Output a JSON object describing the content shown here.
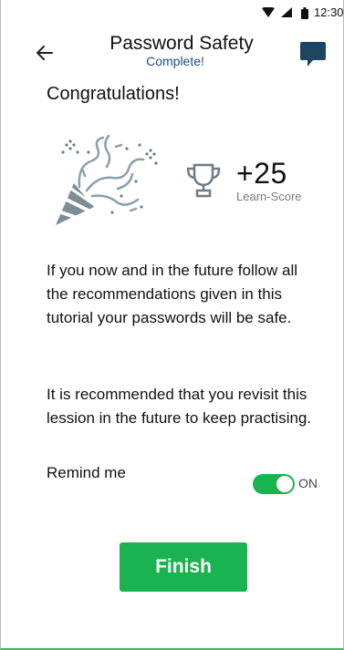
{
  "status_bar": {
    "time": "12:30",
    "icons": [
      "wifi-icon",
      "signal-icon",
      "battery-icon"
    ]
  },
  "header": {
    "back_icon": "arrow-left-icon",
    "title": "Password Safety",
    "subtitle": "Complete!",
    "chat_icon": "chat-bubble-icon"
  },
  "main": {
    "congrats": "Congratulations!",
    "illustration_icon": "party-popper-confetti-icon",
    "score": {
      "icon": "trophy-icon",
      "value": "+25",
      "label": "Learn-Score"
    },
    "paragraph_1": "If you now and in the future follow all the recommendations given in this tutorial your passwords will be safe.",
    "paragraph_2": "It is recommended that you revisit this lession in the future to keep practising.",
    "remind": {
      "label": "Remind me",
      "toggle_on": true,
      "state_label": "ON"
    },
    "finish_button": "Finish"
  },
  "colors": {
    "accent_green": "#19b34f",
    "subtitle_blue": "#1f4e79",
    "muted_gray": "#6f7d86",
    "confetti": "#6b7f8c"
  }
}
